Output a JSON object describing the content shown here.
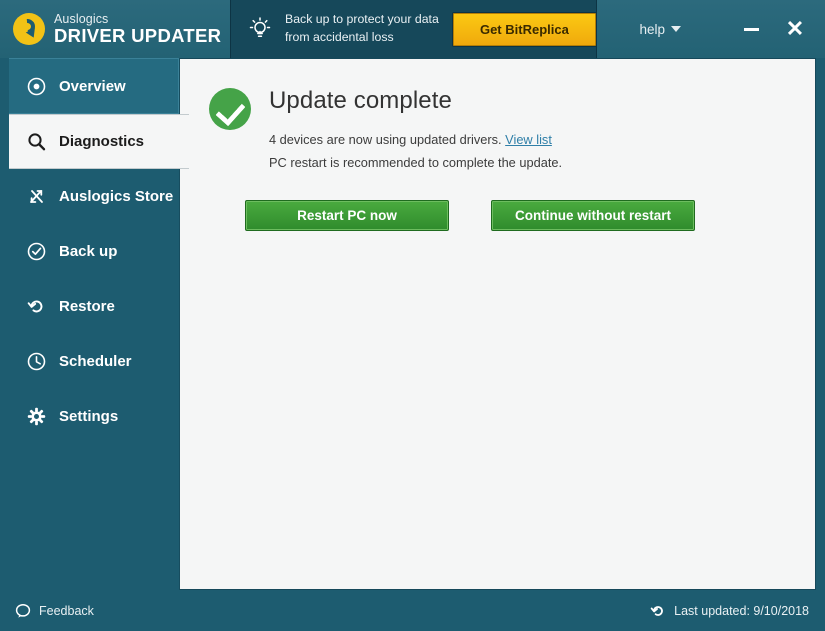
{
  "window": {
    "brand_top": "Auslogics",
    "brand_bottom": "DRIVER UPDATER",
    "help_label": "help",
    "minimize_label": "Minimize",
    "close_label": "✕"
  },
  "promo": {
    "line1": "Back up to protect your data",
    "line2": "from accidental loss",
    "button_label": "Get BitReplica"
  },
  "sidebar": {
    "items": [
      {
        "label": "Overview",
        "icon": "target-icon",
        "state": "first"
      },
      {
        "label": "Diagnostics",
        "icon": "magnifier-icon",
        "state": "active"
      },
      {
        "label": "Auslogics Store",
        "icon": "arrows-exchange-icon",
        "state": "normal"
      },
      {
        "label": "Back up",
        "icon": "check-circle-icon",
        "state": "normal"
      },
      {
        "label": "Restore",
        "icon": "undo-arrow-icon",
        "state": "normal"
      },
      {
        "label": "Scheduler",
        "icon": "clock-icon",
        "state": "normal"
      },
      {
        "label": "Settings",
        "icon": "gear-icon",
        "state": "normal"
      }
    ]
  },
  "main": {
    "status_icon": "green-check-circle-icon",
    "title": "Update complete",
    "line1_prefix": "4 devices are now using updated drivers. ",
    "line1_link": "View list",
    "line2": "PC restart is recommended to complete the update.",
    "restart_button": "Restart PC now",
    "continue_button": "Continue without restart"
  },
  "footer": {
    "feedback_label": "Feedback",
    "last_updated_label": "Last updated: 9/10/2018"
  },
  "colors": {
    "teal": "#1d5c70",
    "teal_dark": "#16485a",
    "accent_yellow": "#f2c216",
    "green": "#45a348",
    "link_blue": "#2f7fa8"
  }
}
